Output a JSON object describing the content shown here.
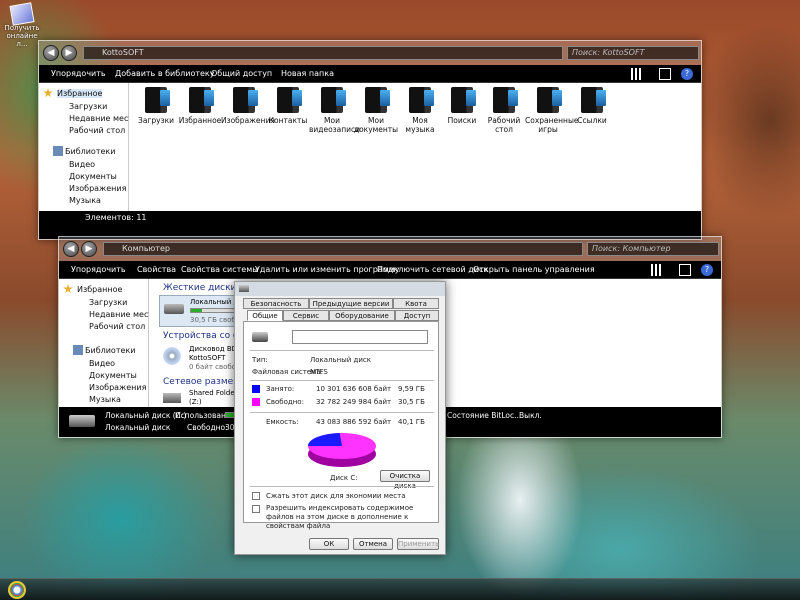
{
  "desktop": {
    "icon_label": "Получить\nонлайне л..."
  },
  "window1": {
    "address": "KottoSOFT",
    "search_placeholder": "Поиск: KottoSOFT",
    "toolbar": [
      "Упорядочить",
      "Добавить в библиотеку",
      "Общий доступ",
      "Новая папка"
    ],
    "nav": {
      "favorites": "Избранное",
      "fav_items": [
        "Загрузки",
        "Недавние места",
        "Рабочий стол"
      ],
      "libraries": "Библиотеки",
      "lib_items": [
        "Видео",
        "Документы",
        "Изображения",
        "Музыка"
      ]
    },
    "items": [
      "Загрузки",
      "Избранное",
      "Изображения",
      "Контакты",
      "Мои видеозаписи",
      "Мои документы",
      "Моя музыка",
      "Поиски",
      "Рабочий стол",
      "Сохраненные игры",
      "Ссылки"
    ],
    "status": "Элементов: 11"
  },
  "window2": {
    "address": "Компьютер",
    "search_placeholder": "Поиск: Компьютер",
    "toolbar": [
      "Упорядочить",
      "Свойства",
      "Свойства системы",
      "Удалить или изменить программу",
      "Подключить сетевой диск",
      "Открыть панель управления"
    ],
    "nav": {
      "favorites": "Избранное",
      "fav_items": [
        "Загрузки",
        "Недавние места",
        "Рабочий стол"
      ],
      "libraries": "Библиотеки",
      "lib_items": [
        "Видео",
        "Документы",
        "Изображения",
        "Музыка"
      ]
    },
    "groups": {
      "hdd": "Жесткие диски (2)",
      "devices": "Устройства со съем...",
      "network": "Сетевое размещен..."
    },
    "drive_c": {
      "label": "Локальный дис...",
      "free": "30,5 ГБ свобод...",
      "fill": 0.24
    },
    "dvd": {
      "label": "Дисковод BD-R...",
      "sub": "KottoSOFT",
      "free": "0 байт свобод..."
    },
    "shared": {
      "label": "Shared Folders",
      "sub": "(Z:)"
    },
    "status": {
      "drive_name": "Локальный диск (C:)",
      "drive_type": "Локальный диск",
      "used_label": "Использовано:",
      "free_label": "Свободно:",
      "free_value": "30,5",
      "bitlocker": "Состояние BitLoc...",
      "bitlocker_value": "Выкл."
    }
  },
  "dialog": {
    "tabs_top": [
      "Безопасность",
      "Предыдущие версии",
      "Квота"
    ],
    "tabs_bottom": [
      "Общие",
      "Сервис",
      "Оборудование",
      "Доступ"
    ],
    "type_label": "Тип:",
    "type_value": "Локальный диск",
    "fs_label": "Файловая система:",
    "fs_value": "NTFS",
    "used_label": "Занято:",
    "used_bytes": "10 301 636 608 байт",
    "used_gb": "9,59 ГБ",
    "free_label": "Свободно:",
    "free_bytes": "32 782 249 984 байт",
    "free_gb": "30,5 ГБ",
    "cap_label": "Емкость:",
    "cap_bytes": "43 083 886 592 байт",
    "cap_gb": "40,1 ГБ",
    "disk_label": "Диск C:",
    "cleanup": "Очистка диска",
    "compress": "Сжать этот диск для экономии места",
    "index": "Разрешить индексировать содержимое файлов на этом диске в дополнение к свойствам файла",
    "ok": "ОК",
    "cancel": "Отмена",
    "apply": "Применить",
    "colors": {
      "used": "#0000ff",
      "free": "#ff00ff"
    }
  }
}
